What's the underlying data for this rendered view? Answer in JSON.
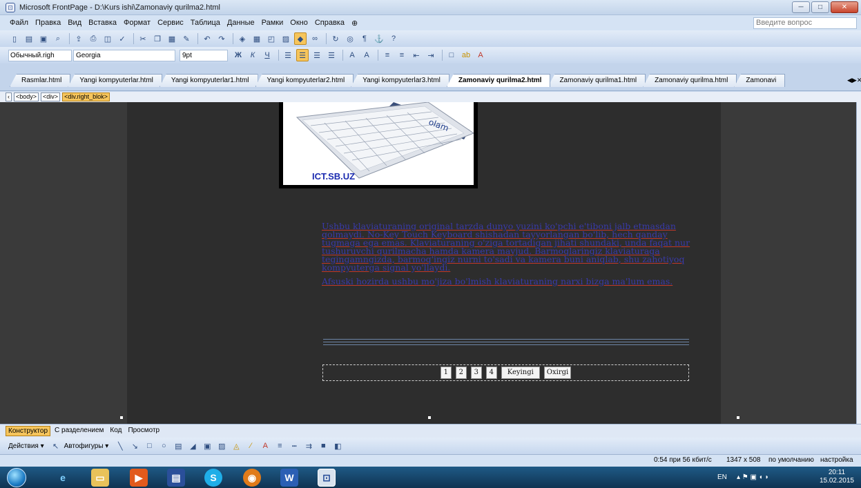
{
  "window": {
    "title": "Microsoft FrontPage - D:\\Kurs ishi\\Zamonaviy qurilma2.html",
    "minimize": "─",
    "maximize": "□",
    "close": "✕"
  },
  "menu": {
    "items": [
      "Файл",
      "Правка",
      "Вид",
      "Вставка",
      "Формат",
      "Сервис",
      "Таблица",
      "Данные",
      "Рамки",
      "Окно",
      "Справка"
    ],
    "help_placeholder": "Введите вопрос"
  },
  "format_toolbar": {
    "style": "Обычный.righ",
    "font": "Georgia",
    "size": "9pt",
    "bold": "Ж",
    "italic": "К",
    "underline": "Ч"
  },
  "tabs": [
    {
      "label": "Rasmlar.html",
      "active": false
    },
    {
      "label": "Yangi kompyuterlar.html",
      "active": false
    },
    {
      "label": "Yangi kompyuterlar1.html",
      "active": false
    },
    {
      "label": "Yangi kompyuterlar2.html",
      "active": false
    },
    {
      "label": "Yangi kompyuterlar3.html",
      "active": false
    },
    {
      "label": "Zamonaviy qurilma2.html",
      "active": true
    },
    {
      "label": "Zamonaviy qurilma1.html",
      "active": false
    },
    {
      "label": "Zamonaviy qurilma.html",
      "active": false
    },
    {
      "label": "Zamonavi",
      "active": false
    }
  ],
  "tag_selector": [
    "<body>",
    "<div>",
    "<div.right_blok>"
  ],
  "page": {
    "image_caption": "ICT.SB.UZ",
    "paragraph1": "Ushbu klaviaturaning original tarzda dunyo yuzini ko'pchi e'tiboni jalb etmasdan qolmaydi. No-Key Touch Keyboard shishadan tayyorlangan bo'lib, hech qanday tugmaga ega emas. Klaviaturaning o'ziga tortadigan jihati shundaki, unda faqat nur tushuruvchi qurilmacha hamda kamera mavjud. Barmoqlaringiz klaviaturaga tegingamngizda, barmoq'ingiz nurni to'sadi va kamera buni aniqlab, shu zahotiyoq kompyuterga signal yo'llaydi.",
    "paragraph2": "Afsuski hozirda ushbu mo'jiza bo'lmish klaviaturaning narxi bizga ma'lum emas.",
    "pager": {
      "pages": [
        "1",
        "2",
        "3",
        "4"
      ],
      "next": "Keyingi",
      "last": "Oxirgi"
    }
  },
  "view_tabs": [
    {
      "label": "Конструктор",
      "active": true
    },
    {
      "label": "С разделением",
      "active": false
    },
    {
      "label": "Код",
      "active": false
    },
    {
      "label": "Просмотр",
      "active": false
    }
  ],
  "drawing_toolbar": {
    "actions": "Действия ▾",
    "autoshapes": "Автофигуры ▾"
  },
  "status": {
    "speed": "0:54 при 56 кбит/с",
    "dimensions": "1347 x 508",
    "default": "по умолчанию",
    "settings": "настройка"
  },
  "taskbar": {
    "lang": "EN",
    "time": "20:11",
    "date": "15.02.2015"
  }
}
